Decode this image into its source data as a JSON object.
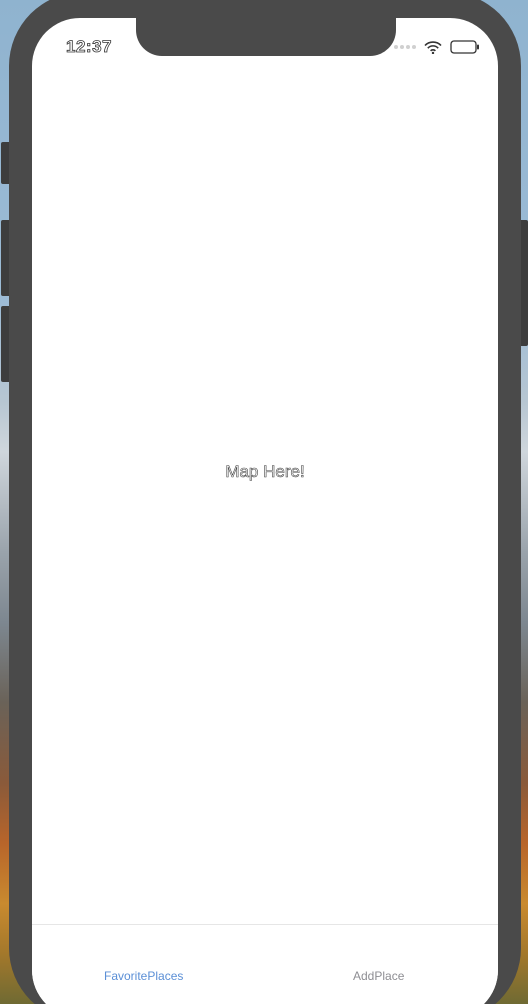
{
  "status_bar": {
    "time": "12:37"
  },
  "main": {
    "placeholder_text": "Map Here!"
  },
  "tab_bar": {
    "tabs": [
      {
        "label": "FavoritePlaces",
        "active": true,
        "color": "#5b8fd6"
      },
      {
        "label": "AddPlace",
        "active": false,
        "color": "#8e8e93"
      }
    ]
  },
  "icons": {
    "signal": "signal-icon",
    "wifi": "wifi-icon",
    "battery": "battery-icon"
  }
}
